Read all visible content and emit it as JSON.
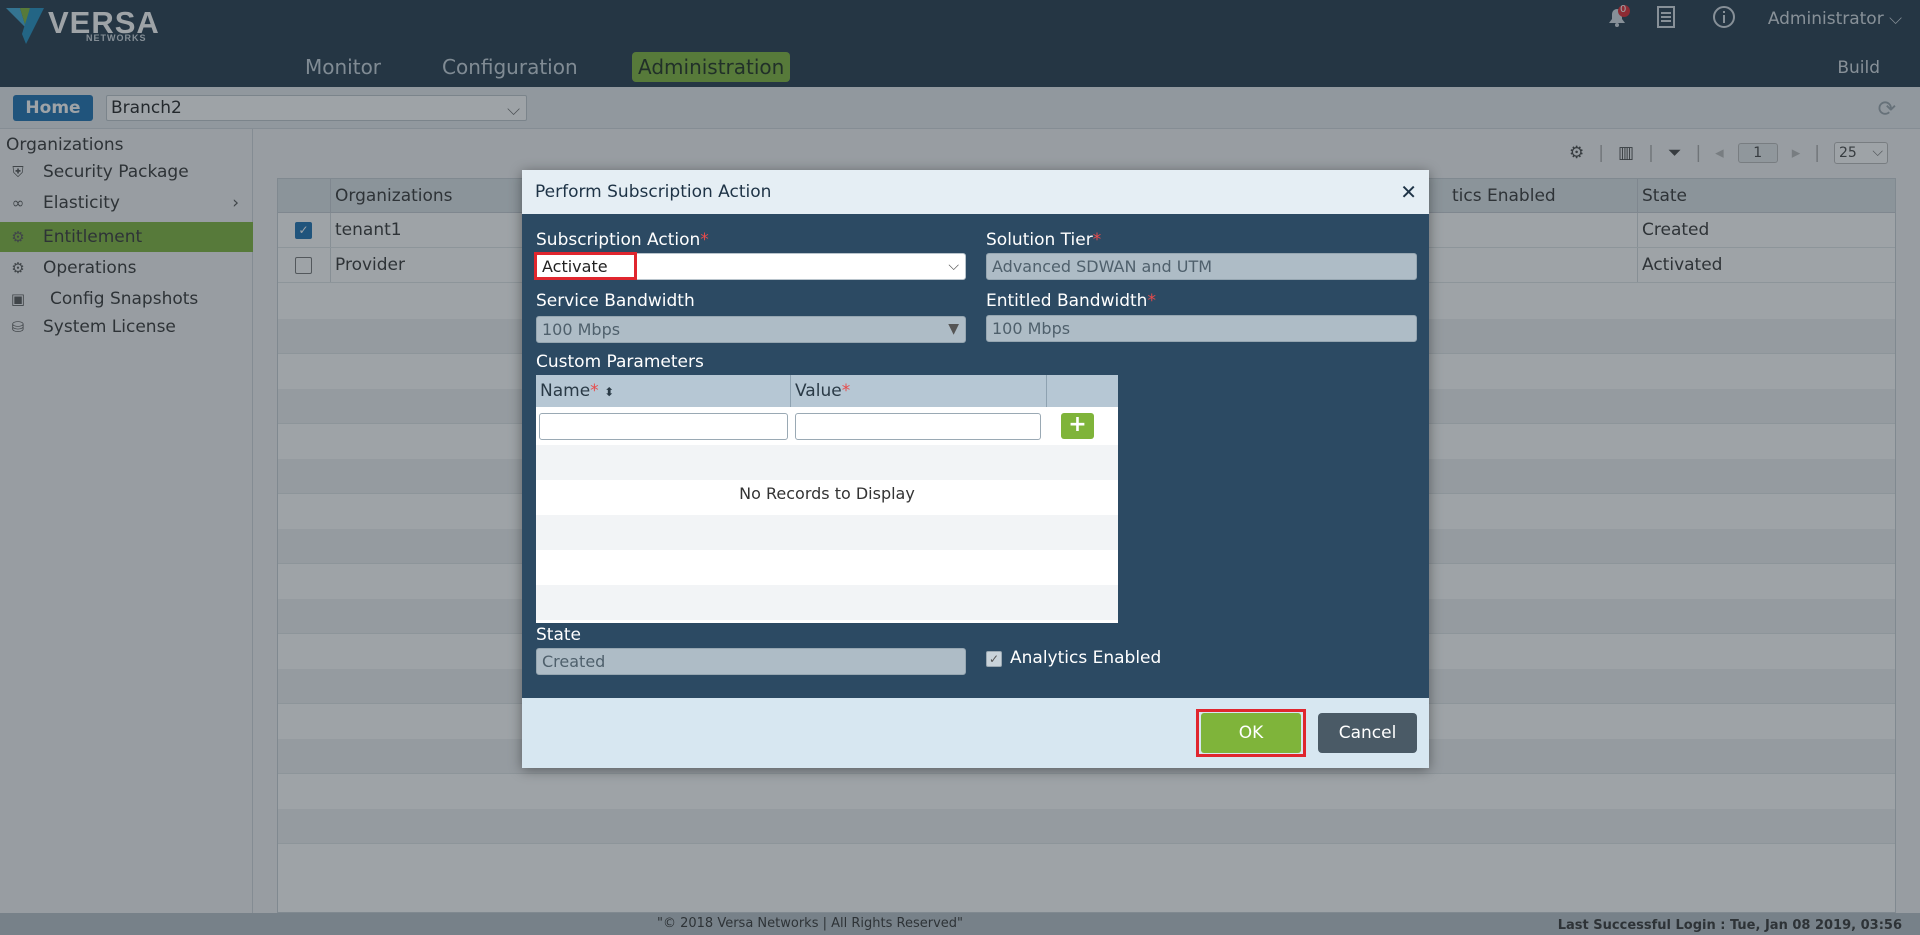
{
  "brand": {
    "name": "VERSA",
    "sub": "NETWORKS"
  },
  "nav": {
    "items": [
      {
        "label": "Monitor"
      },
      {
        "label": "Configuration"
      },
      {
        "label": "Administration"
      }
    ]
  },
  "top_right": {
    "notification_count": "0",
    "user": "Administrator",
    "build": "Build"
  },
  "subbar": {
    "home_label": "Home",
    "org_selected": "Branch2"
  },
  "sidebar": {
    "heading": "Organizations",
    "items": [
      {
        "label": "Security Package"
      },
      {
        "label": "Elasticity"
      },
      {
        "label": "Entitlement"
      },
      {
        "label": "Operations"
      },
      {
        "label": "Config Snapshots"
      },
      {
        "label": "System License"
      }
    ]
  },
  "toolbar": {
    "page": "1",
    "per_page": "25"
  },
  "grid": {
    "columns": [
      "Organizations",
      "tics Enabled",
      "State"
    ],
    "rows": [
      {
        "org": "tenant1",
        "state": "Created",
        "checked": true
      },
      {
        "org": "Provider",
        "state": "Activated",
        "checked": false
      }
    ]
  },
  "dialog": {
    "title": "Perform Subscription Action",
    "subscription_action_label": "Subscription Action",
    "subscription_action_value": "Activate",
    "solution_tier_label": "Solution Tier",
    "solution_tier_value": "Advanced SDWAN and UTM",
    "service_bandwidth_label": "Service Bandwidth",
    "service_bandwidth_value": "100 Mbps",
    "entitled_bandwidth_label": "Entitled Bandwidth",
    "entitled_bandwidth_value": "100 Mbps",
    "custom_params_label": "Custom Parameters",
    "custom_params_columns": {
      "name": "Name",
      "value": "Value"
    },
    "no_records": "No Records to Display",
    "state_label": "State",
    "state_value": "Created",
    "analytics_label": "Analytics Enabled",
    "ok_label": "OK",
    "cancel_label": "Cancel"
  },
  "footer": {
    "copyright": "\"© 2018 Versa Networks | All Rights Reserved\"",
    "last_login": "Last Successful Login : Tue, Jan 08 2019, 03:56"
  },
  "colors": {
    "accent_green": "#7fb43a",
    "header_navy": "#243a4c",
    "dialog_navy": "#2c4a63",
    "highlight_red": "#e0262e"
  }
}
